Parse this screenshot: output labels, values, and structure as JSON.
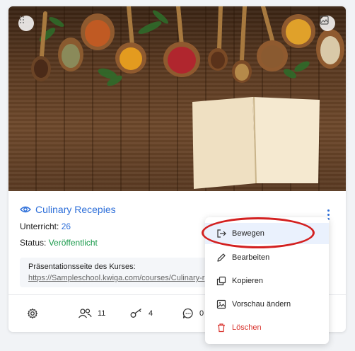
{
  "course": {
    "title": "Culinary Recepies",
    "lessons_label": "Unterricht:",
    "lessons_count": "26",
    "status_label": "Status:",
    "status_value": "Veröffentlicht",
    "presentation_label": "Präsentationsseite des Kurses:",
    "presentation_url": "https://Sampleschool.kwiga.com/courses/Culinary-r"
  },
  "footer": {
    "settings_icon": "gear-icon",
    "users_count": "11",
    "keys_count": "4",
    "comments_count": "0"
  },
  "menu": {
    "items": [
      {
        "label": "Bewegen",
        "icon": "move-icon"
      },
      {
        "label": "Bearbeiten",
        "icon": "pencil-icon"
      },
      {
        "label": "Kopieren",
        "icon": "copy-icon"
      },
      {
        "label": "Vorschau ändern",
        "icon": "image-icon"
      },
      {
        "label": "Löschen",
        "icon": "trash-icon"
      }
    ]
  },
  "colors": {
    "accent": "#2e6fd9",
    "success": "#1a9a4b",
    "danger": "#d8322c",
    "highlight_ring": "#d32020"
  }
}
